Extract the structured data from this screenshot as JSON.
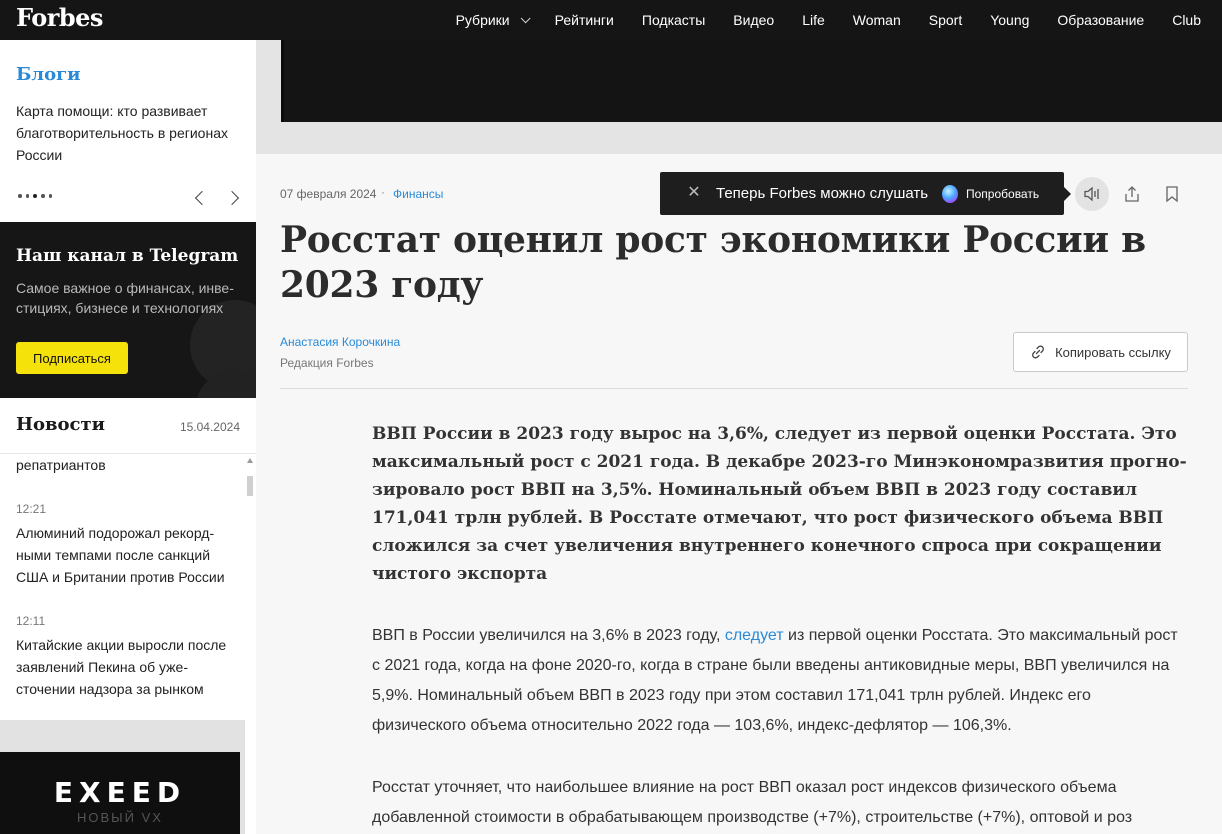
{
  "header": {
    "logo": "Forbes",
    "nav": [
      "Рубрики",
      "Рейтинги",
      "Подкасты",
      "Видео",
      "Life",
      "Woman",
      "Sport",
      "Young",
      "Образование",
      "Club"
    ]
  },
  "sidebar": {
    "blogs": {
      "title": "Блоги",
      "text": "Карта помощи: кто развивает благотворительность в регионах России"
    },
    "telegram": {
      "title": "Наш канал в Telegram",
      "text": "Самое важное о финансах, инве­стициях, бизнесе и технологиях",
      "button": "Подписаться"
    },
    "news": {
      "title": "Новости",
      "date": "15.04.2024",
      "fragment": "репатриантов",
      "items": [
        {
          "time": "12:21",
          "text": "Алюминий подорожал рекорд­ными темпами после санкций США и Британии против России"
        },
        {
          "time": "12:11",
          "text": "Китайские акции выросли по­сле заявлений Пекина об уже­сточении надзора за рынком"
        }
      ]
    },
    "ad": {
      "brand": "EXEED",
      "sub": "НОВЫЙ VX"
    }
  },
  "article": {
    "date": "07 февраля 2024",
    "separator": "·",
    "category": "Финансы",
    "title": "Росстат оценил рост экономики России в 2023 году",
    "author": "Анастасия Корочкина",
    "author_role": "Редакция Forbes",
    "copy_link": "Копировать ссылку",
    "lead": "ВВП России в 2023 году вырос на 3,6%, следует из первой оценки Росстата. Это максимальный рост с 2021 года. В декабре 2023-го Минэкономразвития прогно­зировало рост ВВП на 3,5%. Номинальный объем ВВП в 2023 году составил 171,041 трлн рублей. В Росстате отмечают, что рост физического объема ВВП сложился за счет увеличения внутреннего конечного спроса при сокращении чистого экспорта",
    "para1_a": "ВВП в России увеличился на 3,6% в 2023 году, ",
    "para1_link": "следует",
    "para1_b": " из первой оценки Росстата. Это максимальный рост с 2021 года, когда на фоне 2020-го, когда в стране были введены антиковидные меры, ВВП увели­чился на 5,9%. Номинальный объем ВВП в 2023 году при этом составил 171,041 трлн рублей. Индекс его физического объема относительно 2022 года — 103,6%, индекс-дефлятор — 106,3%.",
    "para2": "Росстат уточняет, что наибольшее влияние на рост ВВП оказал рост индексов физического объема добавленной стоимости в обрабатывающем производстве (+7%), строительстве (+7%), оптовой и роз­"
  },
  "tooltip": {
    "text": "Теперь Forbes можно слушать",
    "action": "Попробовать"
  },
  "colors": {
    "accent": "#2a8ad8",
    "topbar": "#151515",
    "telegram_button": "#f5e20a"
  }
}
